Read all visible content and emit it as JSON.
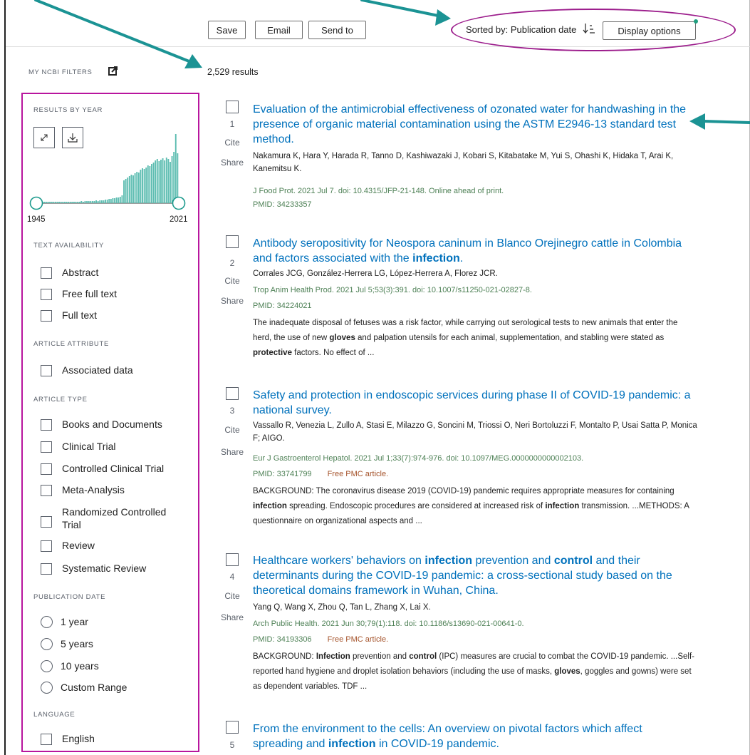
{
  "toolbar": {
    "save": "Save",
    "email": "Email",
    "send_to": "Send to",
    "sorted_by": "Sorted by: Publication date",
    "display_options": "Display options"
  },
  "sidebar": {
    "my_ncbi_filters": "MY NCBI FILTERS",
    "results_by_year": "RESULTS BY YEAR",
    "year_start": "1945",
    "year_end": "2021",
    "text_availability": {
      "heading": "TEXT AVAILABILITY",
      "items": [
        "Abstract",
        "Free full text",
        "Full text"
      ]
    },
    "article_attribute": {
      "heading": "ARTICLE ATTRIBUTE",
      "items": [
        "Associated data"
      ]
    },
    "article_type": {
      "heading": "ARTICLE TYPE",
      "items": [
        "Books and Documents",
        "Clinical Trial",
        "Controlled Clinical Trial",
        "Meta-Analysis",
        "Randomized Controlled Trial",
        "Review",
        "Systematic Review"
      ]
    },
    "publication_date": {
      "heading": "PUBLICATION DATE",
      "items": [
        "1 year",
        "5 years",
        "10 years",
        "Custom Range"
      ]
    },
    "language": {
      "heading": "LANGUAGE",
      "items": [
        "English"
      ]
    }
  },
  "result_count": "2,529 results",
  "actions": {
    "cite": "Cite",
    "share": "Share"
  },
  "results": [
    {
      "num": "1",
      "title": "Evaluation of the antimicrobial effectiveness of ozonated water for handwashing in the presence of organic material contamination using the ASTM E2946-13 standard test method.",
      "authors": "Nakamura K, Hara Y, Harada R, Tanno D, Kashiwazaki J, Kobari S, Kitabatake M, Yui S, Ohashi K, Hidaka T, Arai K, Kanemitsu K.",
      "journal": "J Food Prot. 2021 Jul 7. doi: 10.4315/JFP-21-148. Online ahead of print.",
      "pmid": "PMID: 34233357"
    },
    {
      "num": "2",
      "title_pre": "Antibody seropositivity for Neospora caninum in Blanco Orejinegro cattle in Colombia and factors associated with the ",
      "title_bold": "infection",
      "title_post": ".",
      "authors": "Corrales JCG, González-Herrera LG, López-Herrera A, Florez JCR.",
      "journal": "Trop Anim Health Prod. 2021 Jul 5;53(3):391. doi: 10.1007/s11250-021-02827-8.",
      "pmid": "PMID: 34224021",
      "snippet": {
        "a": "The inadequate disposal of fetuses was a risk factor, while carrying out serological tests to new animals that enter the herd, the use of new ",
        "b": "gloves",
        "c": " and palpation utensils for each animal, supplementation, and stabling were stated as ",
        "d": "protective",
        "e": " factors. No effect of ..."
      }
    },
    {
      "num": "3",
      "title": "Safety and protection in endoscopic services during phase II of COVID-19 pandemic: a national survey.",
      "authors": "Vassallo R, Venezia L, Zullo A, Stasi E, Milazzo G, Soncini M, Triossi O, Neri Bortoluzzi F, Montalto P, Usai Satta P, Monica F; AIGO.",
      "journal": "Eur J Gastroenterol Hepatol. 2021 Jul 1;33(7):974-976. doi: 10.1097/MEG.0000000000002103.",
      "pmid": "PMID: 33741799",
      "free": "Free PMC article.",
      "snippet": {
        "a": "BACKGROUND: The coronavirus disease 2019 (COVID-19) pandemic requires appropriate measures for containing ",
        "b": "infection",
        "c": " spreading. Endoscopic procedures are considered at increased risk of ",
        "d": "infection",
        "e": " transmission. ...METHODS: A questionnaire on organizational aspects and ..."
      }
    },
    {
      "num": "4",
      "title_a": "Healthcare workers' behaviors on ",
      "title_b": "infection",
      "title_c": " prevention and ",
      "title_d": "control",
      "title_e": " and their determinants during the COVID-19 pandemic: a cross-sectional study based on the theoretical domains framework in Wuhan, China.",
      "authors": "Yang Q, Wang X, Zhou Q, Tan L, Zhang X, Lai X.",
      "journal": "Arch Public Health. 2021 Jun 30;79(1):118. doi: 10.1186/s13690-021-00641-0.",
      "pmid": "PMID: 34193306",
      "free": "Free PMC article.",
      "snippet": {
        "a": "BACKGROUND: ",
        "b": "Infection",
        "c": " prevention and ",
        "d": "control",
        "e": " (IPC) measures are crucial to combat the COVID-19 pandemic. ...Self-reported hand hygiene and droplet isolation behaviors (including the use of masks, ",
        "f": "gloves",
        "g": ", goggles and gowns) were set as dependent variables. TDF ..."
      }
    },
    {
      "num": "5",
      "title_a": "From the environment to the cells: An overview on pivotal factors which affect spreading and ",
      "title_b": "infection",
      "title_c": " in COVID-19 pandemic."
    }
  ],
  "histogram": [
    0.02,
    0.02,
    0.02,
    0.02,
    0.02,
    0.02,
    0.02,
    0.02,
    0.02,
    0.02,
    0.02,
    0.02,
    0.02,
    0.02,
    0.02,
    0.02,
    0.02,
    0.02,
    0.02,
    0.02,
    0.02,
    0.02,
    0.02,
    0.02,
    0.03,
    0.02,
    0.03,
    0.03,
    0.03,
    0.03,
    0.03,
    0.03,
    0.04,
    0.03,
    0.04,
    0.04,
    0.04,
    0.05,
    0.05,
    0.06,
    0.06,
    0.07,
    0.07,
    0.08,
    0.08,
    0.09,
    0.11,
    0.32,
    0.34,
    0.36,
    0.38,
    0.4,
    0.39,
    0.42,
    0.44,
    0.43,
    0.47,
    0.49,
    0.48,
    0.5,
    0.53,
    0.52,
    0.55,
    0.57,
    0.6,
    0.62,
    0.59,
    0.61,
    0.63,
    0.6,
    0.64,
    0.62,
    0.58,
    0.66,
    0.72,
    0.97,
    0.7
  ],
  "colors": {
    "link": "#0071bc",
    "bar": "#5dbdb1",
    "annotation": "#b8159e",
    "arrow": "#1b9394"
  }
}
